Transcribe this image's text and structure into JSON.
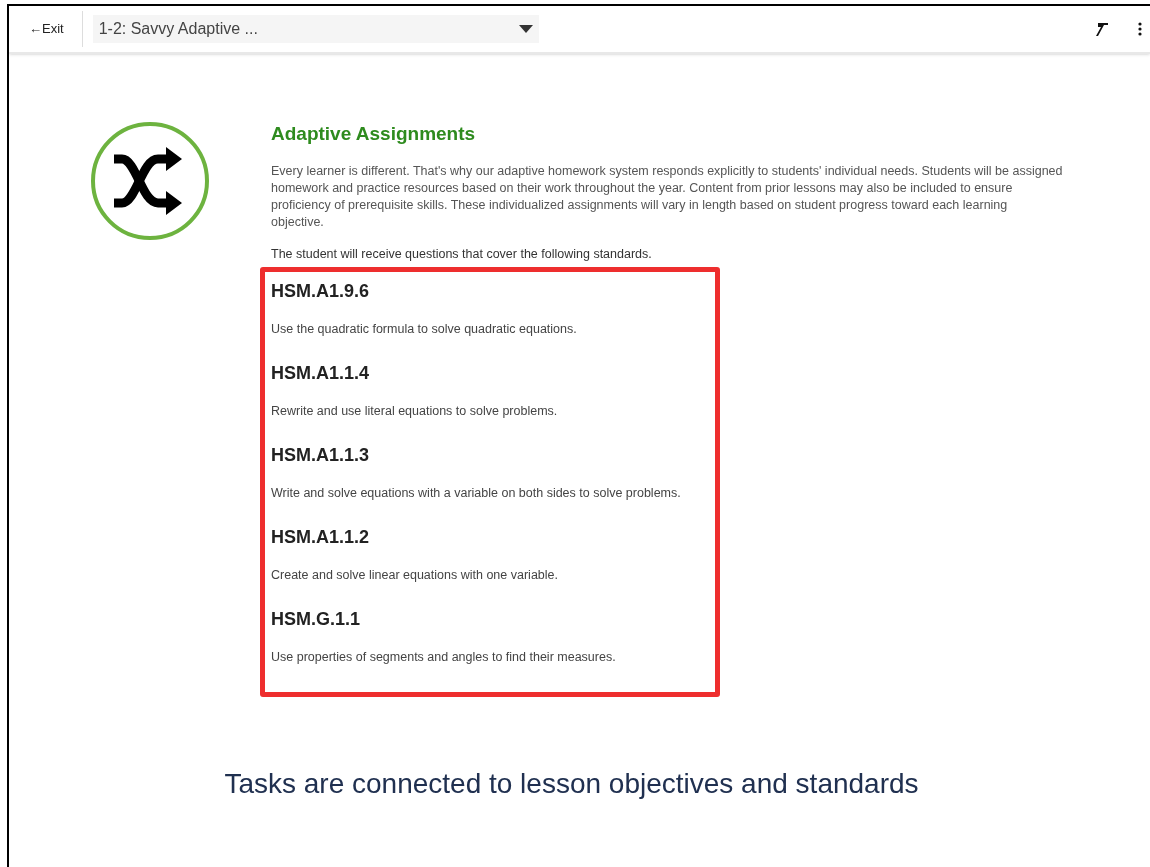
{
  "header": {
    "exit_label": "←Exit",
    "lesson_select": {
      "value": "1-2: Savvy Adaptive ..."
    }
  },
  "section": {
    "title": "Adaptive Assignments",
    "description": "Every learner is different. That's why our adaptive homework system responds explicitly to students' individual needs. Students will be assigned homework and practice resources based on their work throughout the year. Content from prior lessons may also be included to ensure proficiency of prerequisite skills. These individualized assignments will vary in length based on student progress toward each learning objective.",
    "standards_intro": "The student will receive questions that cover the following standards.",
    "standards": [
      {
        "code": "HSM.A1.9.6",
        "description": "Use the quadratic formula to solve quadratic equations."
      },
      {
        "code": "HSM.A1.1.4",
        "description": "Rewrite and use literal equations to solve problems."
      },
      {
        "code": "HSM.A1.1.3",
        "description": "Write and solve equations with a variable on both sides to solve problems."
      },
      {
        "code": "HSM.A1.1.2",
        "description": "Create and solve linear equations with one variable."
      },
      {
        "code": "HSM.G.1.1",
        "description": "Use properties of segments and angles to find their measures."
      }
    ]
  },
  "caption": "Tasks are connected to lesson objectives and standards"
}
